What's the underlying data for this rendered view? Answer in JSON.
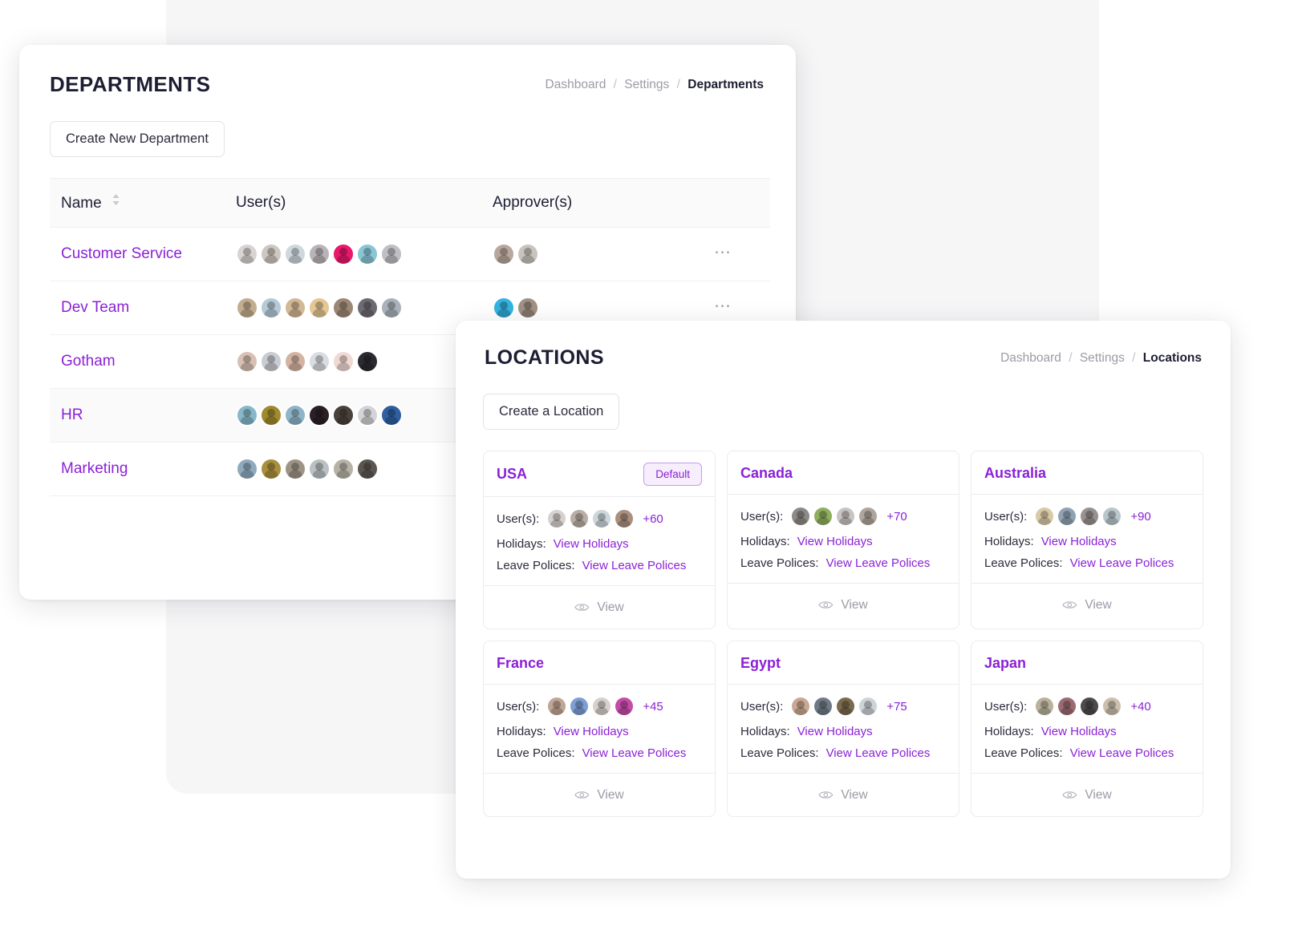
{
  "departments": {
    "title": "DEPARTMENTS",
    "breadcrumb": {
      "root": "Dashboard",
      "section": "Settings",
      "current": "Departments",
      "separator": "/"
    },
    "create_button": "Create New Department",
    "columns": {
      "name": "Name",
      "users": "User(s)",
      "approvers": "Approver(s)",
      "actions": ""
    },
    "sort_icon": "sort-arrows-icon",
    "row_menu_label": "⋯",
    "rows": [
      {
        "name": "Customer Service",
        "user_count": 7,
        "approver_count": 2,
        "highlight": false,
        "user_colors": [
          "#d9d4d2",
          "#cfc7c1",
          "#cfd8dd",
          "#b9b4b8",
          "#e8186c",
          "#88c6d6",
          "#bfbfc4"
        ],
        "approver_colors": [
          "#b8a79c",
          "#c8c4bd"
        ]
      },
      {
        "name": "Dev Team",
        "user_count": 7,
        "approver_count": 2,
        "highlight": false,
        "user_colors": [
          "#c2ad8f",
          "#b5c9d6",
          "#d2b894",
          "#e4c793",
          "#9c8775",
          "#6d6a72",
          "#a9b2bb"
        ],
        "approver_colors": [
          "#34b3e0",
          "#a09184"
        ]
      },
      {
        "name": "Gotham",
        "user_count": 6,
        "approver_count": 0,
        "highlight": false,
        "user_colors": [
          "#d8c0b4",
          "#c9ccd2",
          "#d3b3a2",
          "#d9dce0",
          "#f0d9d4",
          "#2a2a30"
        ],
        "approver_colors": []
      },
      {
        "name": "HR",
        "user_count": 7,
        "approver_count": 0,
        "highlight": true,
        "user_colors": [
          "#86b8c9",
          "#a08a2e",
          "#8fb4c8",
          "#2b2025",
          "#4a413c",
          "#d4d4d8",
          "#2f5fa0"
        ],
        "approver_colors": []
      },
      {
        "name": "Marketing",
        "user_count": 6,
        "approver_count": 0,
        "highlight": false,
        "user_colors": [
          "#8fa9bd",
          "#a88f3c",
          "#9e9486",
          "#b9c1c4",
          "#b7b2a6",
          "#5d5650"
        ],
        "approver_colors": []
      }
    ]
  },
  "locations": {
    "title": "LOCATIONS",
    "breadcrumb": {
      "root": "Dashboard",
      "section": "Settings",
      "current": "Locations",
      "separator": "/"
    },
    "create_button": "Create a Location",
    "labels": {
      "users": "User(s):",
      "holidays": "Holidays:",
      "leave_polices": "Leave Polices:",
      "view_holidays": "View Holidays",
      "view_leave_polices": "View Leave Polices",
      "view": "View",
      "view_icon": "eye-icon"
    },
    "cards": [
      {
        "name": "USA",
        "default_badge": "Default",
        "more_users": "+60",
        "avatar_colors": [
          "#d6d1cf",
          "#b9ada3",
          "#cdd6da",
          "#a98f7e"
        ]
      },
      {
        "name": "Canada",
        "default_badge": null,
        "more_users": "+70",
        "avatar_colors": [
          "#8d8a86",
          "#8fae5e",
          "#c9c4c2",
          "#b0a59c"
        ]
      },
      {
        "name": "Australia",
        "default_badge": null,
        "more_users": "+90",
        "avatar_colors": [
          "#d9c9a6",
          "#8fa3b4",
          "#97918f",
          "#b9c6cc"
        ]
      },
      {
        "name": "France",
        "default_badge": null,
        "more_users": "+45",
        "avatar_colors": [
          "#c0a694",
          "#7e9ed4",
          "#d8d0cb",
          "#c54ba9"
        ]
      },
      {
        "name": "Egypt",
        "default_badge": null,
        "more_users": "+75",
        "avatar_colors": [
          "#caa893",
          "#6f7a84",
          "#7a6a4e",
          "#cdd3d8"
        ]
      },
      {
        "name": "Japan",
        "default_badge": null,
        "more_users": "+40",
        "avatar_colors": [
          "#b8b29c",
          "#9c6b72",
          "#4d4a4c",
          "#cbbfae"
        ]
      }
    ]
  },
  "theme": {
    "accent": "#8b21d6",
    "heading": "#1d1d33",
    "muted": "#9b9ba6",
    "panel_bg": "#ffffff",
    "plate_bg": "#f6f6f7",
    "row_highlight": "#fafafb",
    "badge_bg": "#f6edfd",
    "badge_border": "#c99af0"
  }
}
